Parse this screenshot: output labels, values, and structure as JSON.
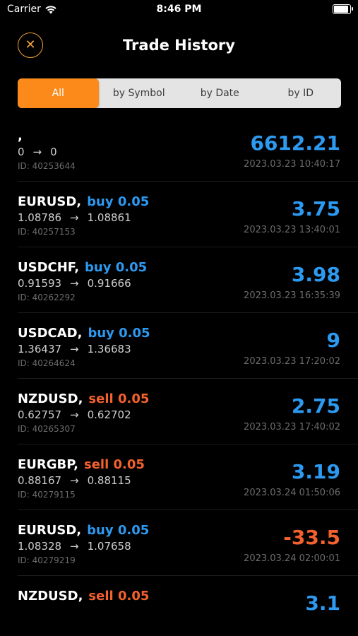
{
  "status_bar": {
    "carrier": "Carrier",
    "time": "8:46 PM"
  },
  "header": {
    "title": "Trade History",
    "close_symbol": "✕"
  },
  "filter_tabs": [
    {
      "label": "All",
      "active": true
    },
    {
      "label": "by Symbol",
      "active": false
    },
    {
      "label": "by Date",
      "active": false
    },
    {
      "label": "by ID",
      "active": false
    }
  ],
  "colors": {
    "accent": "#fb8a1a",
    "buy": "#2d9af2",
    "sell": "#f3612d",
    "positive": "#2d9af2",
    "negative": "#f3612d"
  },
  "trades": [
    {
      "symbol": ",",
      "side": "",
      "side_type": "",
      "open_price": "0",
      "close_price": "0",
      "id": "ID: 40253644",
      "profit": "6612.21",
      "profit_type": "positive",
      "datetime": "2023.03.23 10:40:17"
    },
    {
      "symbol": "EURUSD,",
      "side": "buy 0.05",
      "side_type": "buy",
      "open_price": "1.08786",
      "close_price": "1.08861",
      "id": "ID: 40257153",
      "profit": "3.75",
      "profit_type": "positive",
      "datetime": "2023.03.23 13:40:01"
    },
    {
      "symbol": "USDCHF,",
      "side": "buy 0.05",
      "side_type": "buy",
      "open_price": "0.91593",
      "close_price": "0.91666",
      "id": "ID: 40262292",
      "profit": "3.98",
      "profit_type": "positive",
      "datetime": "2023.03.23 16:35:39"
    },
    {
      "symbol": "USDCAD,",
      "side": "buy 0.05",
      "side_type": "buy",
      "open_price": "1.36437",
      "close_price": "1.36683",
      "id": "ID: 40264624",
      "profit": "9",
      "profit_type": "positive",
      "datetime": "2023.03.23 17:20:02"
    },
    {
      "symbol": "NZDUSD,",
      "side": "sell 0.05",
      "side_type": "sell",
      "open_price": "0.62757",
      "close_price": "0.62702",
      "id": "ID: 40265307",
      "profit": "2.75",
      "profit_type": "positive",
      "datetime": "2023.03.23 17:40:02"
    },
    {
      "symbol": "EURGBP,",
      "side": "sell 0.05",
      "side_type": "sell",
      "open_price": "0.88167",
      "close_price": "0.88115",
      "id": "ID: 40279115",
      "profit": "3.19",
      "profit_type": "positive",
      "datetime": "2023.03.24 01:50:06"
    },
    {
      "symbol": "EURUSD,",
      "side": "buy 0.05",
      "side_type": "buy",
      "open_price": "1.08328",
      "close_price": "1.07658",
      "id": "ID: 40279219",
      "profit": "-33.5",
      "profit_type": "negative",
      "datetime": "2023.03.24 02:00:01"
    },
    {
      "symbol": "NZDUSD,",
      "side": "sell 0.05",
      "side_type": "sell",
      "open_price": "",
      "close_price": "",
      "id": "",
      "profit": "3.1",
      "profit_type": "positive",
      "datetime": ""
    }
  ]
}
